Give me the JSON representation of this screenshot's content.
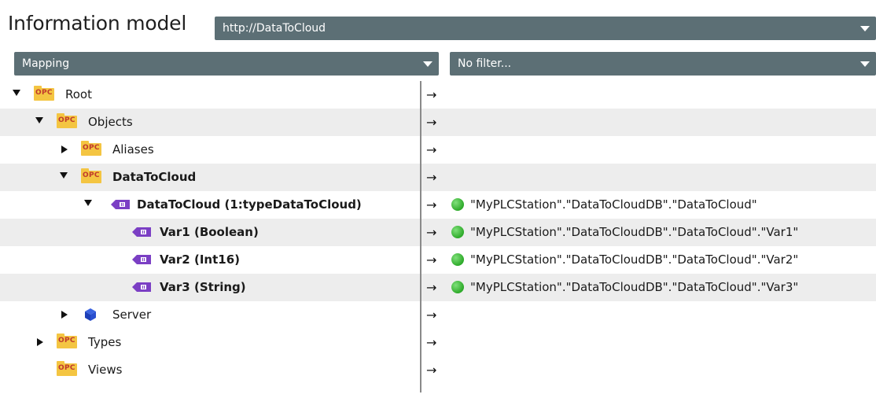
{
  "header": {
    "title": "Information model",
    "url_value": "http://DataToCloud"
  },
  "toolbar": {
    "mapping_value": "Mapping",
    "filter_value": "No filter..."
  },
  "colors": {
    "dropdown_bg": "#5c6f75",
    "row_alt_bg": "#ededed",
    "opc_folder": "#f4c542",
    "status_green": "#2eaa2a"
  },
  "tree": {
    "rows": [
      {
        "label": "Root",
        "icon": "opc-folder-icon",
        "expander": "expanded",
        "mapping_arrow": "→",
        "mapping": ""
      },
      {
        "label": "Objects",
        "icon": "opc-folder-icon",
        "expander": "expanded",
        "mapping_arrow": "→",
        "mapping": ""
      },
      {
        "label": "Aliases",
        "icon": "opc-folder-icon",
        "expander": "collapsed",
        "mapping_arrow": "→",
        "mapping": ""
      },
      {
        "label": "DataToCloud",
        "icon": "opc-folder-icon",
        "expander": "expanded",
        "mapping_arrow": "→",
        "mapping": ""
      },
      {
        "label": "DataToCloud (1:typeDataToCloud)",
        "icon": "variable-icon",
        "expander": "expanded",
        "mapping_arrow": "→",
        "mapping": "\"MyPLCStation\".\"DataToCloudDB\".\"DataToCloud\""
      },
      {
        "label": "Var1 (Boolean)",
        "icon": "variable-icon",
        "expander": "none",
        "mapping_arrow": "→",
        "mapping": "\"MyPLCStation\".\"DataToCloudDB\".\"DataToCloud\".\"Var1\""
      },
      {
        "label": "Var2 (Int16)",
        "icon": "variable-icon",
        "expander": "none",
        "mapping_arrow": "→",
        "mapping": "\"MyPLCStation\".\"DataToCloudDB\".\"DataToCloud\".\"Var2\""
      },
      {
        "label": "Var3 (String)",
        "icon": "variable-icon",
        "expander": "none",
        "mapping_arrow": "→",
        "mapping": "\"MyPLCStation\".\"DataToCloudDB\".\"DataToCloud\".\"Var3\""
      },
      {
        "label": "Server",
        "icon": "cube-icon",
        "expander": "collapsed",
        "mapping_arrow": "→",
        "mapping": ""
      },
      {
        "label": "Types",
        "icon": "opc-folder-icon",
        "expander": "collapsed",
        "mapping_arrow": "→",
        "mapping": ""
      },
      {
        "label": "Views",
        "icon": "opc-folder-icon",
        "expander": "none",
        "mapping_arrow": "→",
        "mapping": ""
      }
    ],
    "opc_badge": "OPC"
  }
}
